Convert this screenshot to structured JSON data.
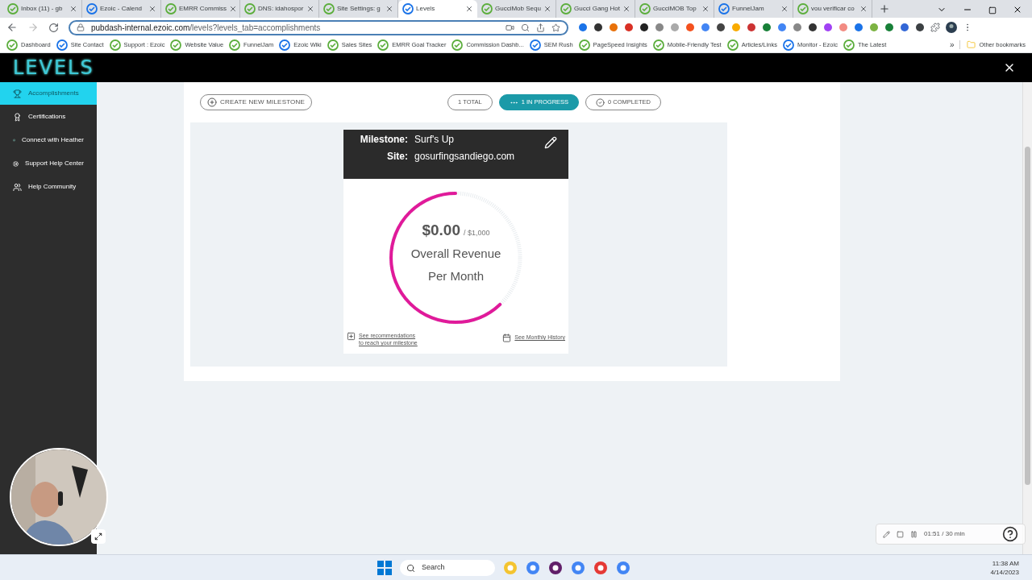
{
  "browser": {
    "tabs": [
      {
        "label": "Inbox (11) - gb",
        "selected": false
      },
      {
        "label": "Ezoic - Calend",
        "selected": false
      },
      {
        "label": "EMRR Commiss",
        "selected": false
      },
      {
        "label": "DNS: idahospor",
        "selected": false
      },
      {
        "label": "Site Settings: g",
        "selected": false
      },
      {
        "label": "Levels",
        "selected": true
      },
      {
        "label": "GucciMob Sequ",
        "selected": false
      },
      {
        "label": "Gucci Gang Hot",
        "selected": false
      },
      {
        "label": "GucciMOB Top",
        "selected": false
      },
      {
        "label": "FunnelJam",
        "selected": false
      },
      {
        "label": "vou verificar co",
        "selected": false
      }
    ],
    "url_host": "pubdash-internal.ezoic.com",
    "url_path": "/levels?levels_tab=accomplishments",
    "bookmarks": [
      "Dashboard",
      "Site Contact",
      "Support : Ezoic",
      "Website Value",
      "FunnelJam",
      "Ezoic Wiki",
      "Sales Sites",
      "EMRR Goal Tracker",
      "Commission Dashb...",
      "SEM Rush",
      "PageSpeed Insights",
      "Mobile-Friendly Test",
      "Articles/Links",
      "Monitor - Ezoic",
      "The Latest"
    ],
    "more": "»",
    "other_bookmarks": "Other bookmarks"
  },
  "app": {
    "logo": "LEVELS",
    "sidebar": [
      {
        "label": "Accomplishments",
        "selected": true
      },
      {
        "label": "Certifications",
        "selected": false
      },
      {
        "label": "Connect with Heather",
        "selected": false
      },
      {
        "label": "Support Help Center",
        "selected": false
      },
      {
        "label": "Help Community",
        "selected": false
      }
    ],
    "create_button": "CREATE NEW MILESTONE",
    "filters": [
      {
        "label": "1 TOTAL",
        "selected": false
      },
      {
        "label": "1 IN PROGRESS",
        "selected": true
      },
      {
        "label": "0 COMPLETED",
        "selected": false
      }
    ],
    "milestone": {
      "milestone_label": "Milestone:",
      "milestone_value": "Surf's Up",
      "site_label": "Site:",
      "site_value": "gosurfingsandiego.com",
      "amount": "$0.00",
      "goal": "/ $1,000",
      "caption_1": "Overall Revenue",
      "caption_2": "Per Month",
      "level": 0.62,
      "recommendations_1": "See recommendations",
      "recommendations_2": "to reach your milestone",
      "history": "See Monthly History"
    }
  },
  "recorder": {
    "time": "01:51 / 30 min"
  },
  "taskbar": {
    "search": "Search",
    "time": "11:38 AM",
    "date": "4/14/2023"
  }
}
